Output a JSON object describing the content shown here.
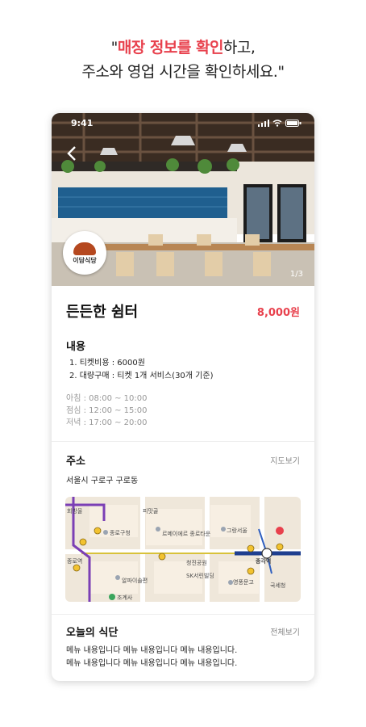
{
  "headline": {
    "open_quote": "\"",
    "highlight": "매장 정보를 확인",
    "rest_line1": "하고,",
    "line2": "주소와 영업 시간을 확인하세요.\""
  },
  "status_bar": {
    "time": "9:41"
  },
  "hero": {
    "photo_counter": "1/3",
    "logo_text": "이담식당"
  },
  "store": {
    "name": "든든한 쉼터",
    "price": "8,000원"
  },
  "content": {
    "heading": "내용",
    "items": [
      "1. 티켓비용 : 6000원",
      "2. 대량구매 : 티켓 1개 서비스(30개 기준)"
    ],
    "hours": [
      "아침 : 08:00 ~ 10:00",
      "점심 : 12:00 ~ 15:00",
      "저녁 : 17:00 ~ 20:00"
    ]
  },
  "address": {
    "heading": "주소",
    "map_link": "지도보기",
    "value": "서울시 구로구 구로동"
  },
  "map_labels": {
    "area": "회방울",
    "station": "종각역",
    "station_left": "종로역",
    "landmark": "피맛골",
    "label_a": "종로구청",
    "label_b": "르메이에르 종로타운",
    "label_c": "그랑서울",
    "label_d": "청진공원",
    "label_e": "SK서린빌딩",
    "label_f": "영풍문고",
    "label_g": "알파이솔편",
    "label_h": "조계사",
    "label_i": "국세청"
  },
  "menu": {
    "heading": "오늘의 식단",
    "all_link": "전체보기",
    "lines": [
      "메뉴 내용입니다 메뉴 내용입니다 메뉴 내용입니다.",
      "메뉴 내용입니다 메뉴 내용입니다 메뉴 내용입니다."
    ]
  },
  "colors": {
    "accent": "#e8414d"
  }
}
